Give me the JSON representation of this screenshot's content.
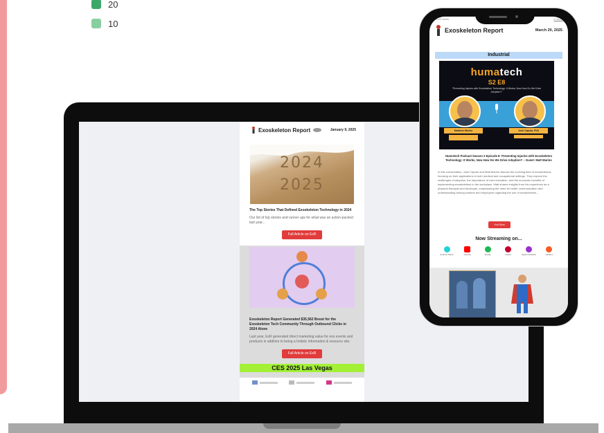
{
  "legend": {
    "items": [
      {
        "label": "20",
        "color": "#3ea86a"
      },
      {
        "label": "10",
        "color": "#87cfa0"
      }
    ]
  },
  "laptop_newsletter": {
    "brand": "Exoskeleton Report",
    "date": "January 9, 2025",
    "hero_years": [
      "2024",
      "2025"
    ],
    "article1": {
      "title": "The Top Stories That Defined Exoskeleton Technology in 2024",
      "desc": "Our list of top stories and runner ups for what was an action-packed last year...",
      "cta": "Full Article on ExR"
    },
    "article2": {
      "title": "Exoskeleton Report Generated $35,562 Boost for the Exoskeleton Tech Community Through Outbound Clicks in 2024 Alone",
      "desc": "Last year, ExR generated direct marketing value for exo events and products in addition to being a holistic information & resource site.",
      "cta": "Full Article on ExR"
    },
    "banner": "CES 2025 Las Vegas"
  },
  "phone_newsletter": {
    "topbar_left": "2025 Week",
    "topbar_right": "in browser",
    "brand": "Exoskeleton Report",
    "date": "March 20, 2025",
    "section": "Industrial",
    "podcast": {
      "logo_a": "huma",
      "logo_b": "tech",
      "episode": "S2 E8",
      "quote": "\"Preventing Injuries with Exoskeleton Technology: It Works, Now How Do We Drive Adoption?\"",
      "guest1": "Matthew Marino",
      "guest2": "Josh Caputo, PhD"
    },
    "title": "Humotech Podcast Season 2 Episode 8: Preventing Injuries with Exoskeleton Technology: It Works, Now How Do We Drive Adoption? – Guest: Matt Marino",
    "desc": "In this conversation, Josh Caputo and Matt Marino discuss the evolving field of exoskeletons, focusing on their applications in both medical and occupational settings. They explore the challenges of adoption, the importance of user education, and the economic benefits of implementing exoskeletons in the workplace. Matt shares insights from his experience as a physical therapist and developer, emphasizing the need for better communication and understanding among workers and employers regarding the use of exoskeletons...",
    "youtube_label": "YouTube",
    "now_streaming": "Now Streaming on...",
    "platforms": [
      {
        "name": "Amazon Music",
        "color": "#25d1da"
      },
      {
        "name": "Youtube",
        "color": "#ff0000"
      },
      {
        "name": "Spotify",
        "color": "#1db954"
      },
      {
        "name": "iHeart",
        "color": "#c6002b"
      },
      {
        "name": "Apple Podcasts",
        "color": "#9933cc"
      },
      {
        "name": "Castbox",
        "color": "#f55b23"
      }
    ]
  }
}
